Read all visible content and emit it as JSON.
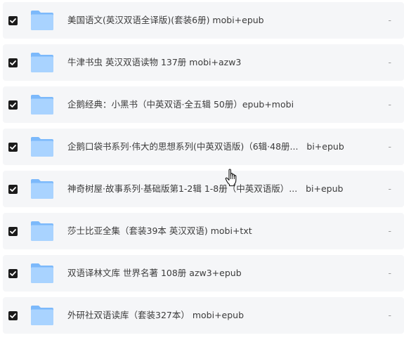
{
  "files": [
    {
      "name": "美国语文(英汉双语全译版)(套装6册) mobi+epub",
      "size": "-",
      "checked": true
    },
    {
      "name": "牛津书虫 英汉双语读物 137册 mobi+azw3",
      "size": "-",
      "checked": true
    },
    {
      "name": "企鹅经典：小黑书（中英双语·全五辑 50册）epub+mobi",
      "size": "-",
      "checked": true
    },
    {
      "name": "企鹅口袋书系列·伟大的思想系列(中英双语版)（6辑·48册...   bi+epub",
      "size": "-",
      "checked": true
    },
    {
      "name": "神奇树屋·故事系列·基础版第1-2辑 1-8册（中英双语版）...   bi+epub",
      "size": "-",
      "checked": true
    },
    {
      "name": "莎士比亚全集（套装39本 英汉双语) mobi+txt",
      "size": "-",
      "checked": true
    },
    {
      "name": "双语译林文库 世界名著 108册 azw3+epub",
      "size": "-",
      "checked": true
    },
    {
      "name": "外研社双语读库（套装327本） mobi+epub",
      "size": "-",
      "checked": true
    }
  ],
  "icons": {
    "row_icon": "folder-icon",
    "checkbox_icon": "checkmark-icon",
    "cursor": "hand-pointer-cursor-icon"
  },
  "colors": {
    "row_background": "#f5f6f8",
    "checkbox": "#1b1b1b",
    "folder_light": "#a9d3ff",
    "folder_dark": "#7cb9fb",
    "text": "#3b3b3b",
    "size_text": "#9a9a9a"
  }
}
